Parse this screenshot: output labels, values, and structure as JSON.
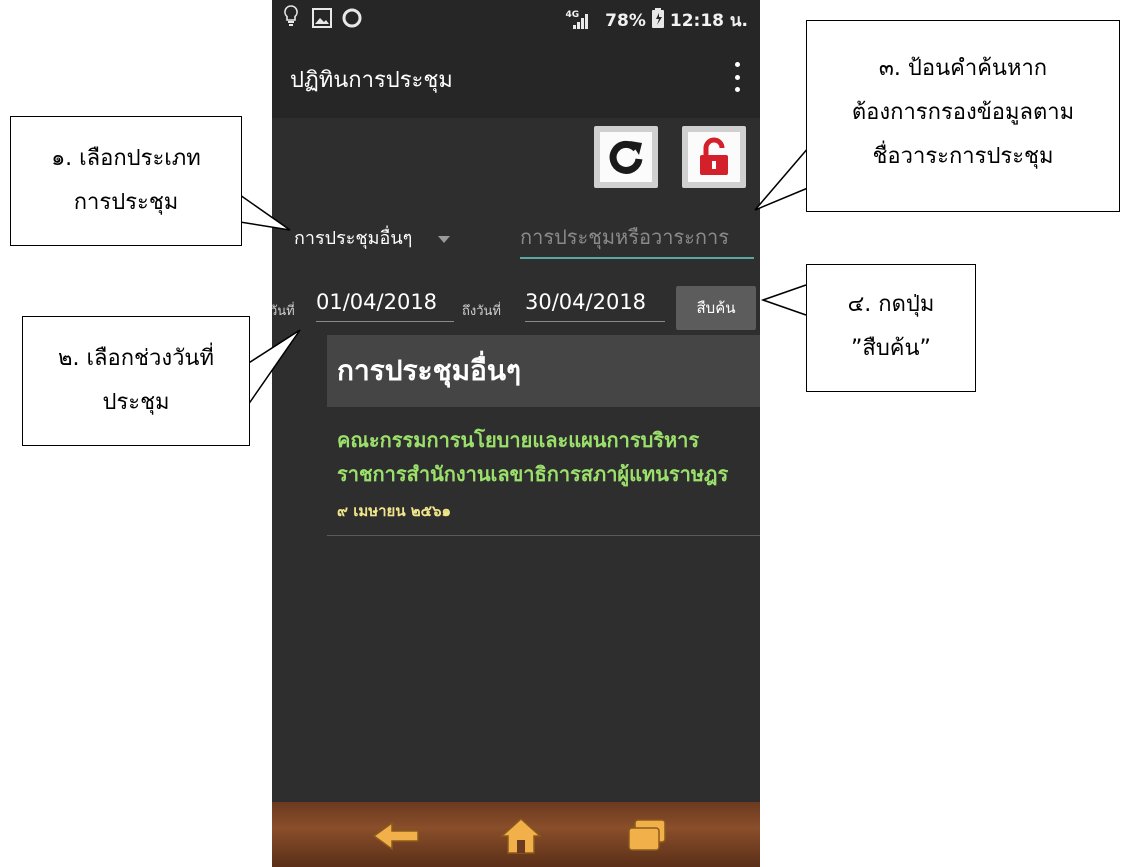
{
  "status_bar": {
    "network": "4G",
    "battery": "78%",
    "time": "12:18 น."
  },
  "app_bar": {
    "title": "ปฏิทินการประชุม"
  },
  "filters": {
    "meeting_type": "การประชุมอื่นๆ",
    "search_placeholder": "การประชุมหรือวาระการ"
  },
  "date_range": {
    "from_label": "วันที่",
    "from_value": "01/04/2018",
    "to_label": "ถึงวันที่",
    "to_value": "30/04/2018",
    "search_button": "สืบค้น"
  },
  "list": {
    "header": "การประชุมอื่นๆ",
    "items": [
      {
        "title": "คณะกรรมการนโยบายและแผนการบริหารราชการสำนักงานเลขาธิการสภาผู้แทนราษฎร",
        "date": "๙ เมษายน ๒๕๖๑"
      }
    ]
  },
  "callouts": {
    "c1": [
      "๑. เลือกประเภท",
      "การประชุม"
    ],
    "c2": [
      "๒. เลือกช่วงวันที่",
      "ประชุม"
    ],
    "c3": [
      "๓. ป้อนคำค้นหาก",
      "ต้องการกรองข้อมูลตาม",
      "ชื่อวาระการประชุม"
    ],
    "c4": [
      "๔. กดปุ่ม",
      "”สืบค้น”"
    ]
  },
  "colors": {
    "background": "#2e2e2e",
    "accent_underline": "#5aa6a0",
    "item_title": "#9be06b",
    "item_date": "#f0e58a",
    "unlock_red": "#d4202a"
  },
  "icons": {
    "refresh": "refresh-icon",
    "unlock": "unlock-icon",
    "back": "back-arrow-icon",
    "home": "home-icon",
    "recents": "recent-apps-icon"
  }
}
